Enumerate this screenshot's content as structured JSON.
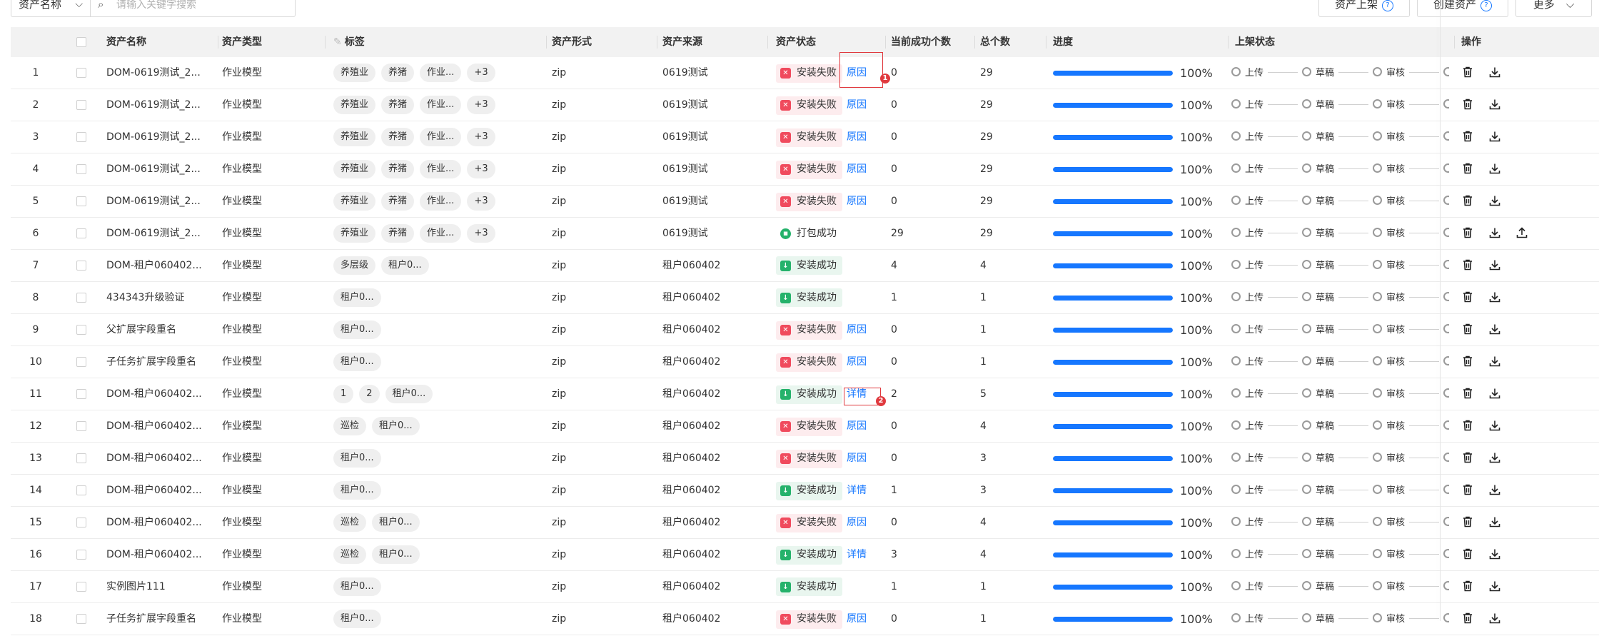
{
  "toolbar": {
    "field_select": "资产名称",
    "search_placeholder": "请输入关键字搜索",
    "publish_label": "资产上架",
    "create_label": "创建资产",
    "more_label": "更多"
  },
  "table": {
    "headers": {
      "name": "资产名称",
      "type": "资产类型",
      "tags": "标签",
      "form": "资产形式",
      "source": "资产来源",
      "status": "资产状态",
      "success": "当前成功个数",
      "total": "总个数",
      "progress": "进度",
      "publish": "上架状态",
      "ops": "操作"
    },
    "steps": [
      "上传",
      "草稿",
      "审核"
    ],
    "rows": [
      {
        "idx": "1",
        "name": "DOM-0619测试_2...",
        "type": "作业模型",
        "tags": [
          "养殖业",
          "养猪",
          "作业..."
        ],
        "more": "+3",
        "form": "zip",
        "source": "0619测试",
        "status": "fail",
        "status_text": "安装失败",
        "link": "原因",
        "success": "0",
        "total": "29",
        "progress_text": "100%",
        "progress": 1.0,
        "upload": false
      },
      {
        "idx": "2",
        "name": "DOM-0619测试_2...",
        "type": "作业模型",
        "tags": [
          "养殖业",
          "养猪",
          "作业..."
        ],
        "more": "+3",
        "form": "zip",
        "source": "0619测试",
        "status": "fail",
        "status_text": "安装失败",
        "link": "原因",
        "success": "0",
        "total": "29",
        "progress_text": "100%",
        "progress": 1.0,
        "upload": false
      },
      {
        "idx": "3",
        "name": "DOM-0619测试_2...",
        "type": "作业模型",
        "tags": [
          "养殖业",
          "养猪",
          "作业..."
        ],
        "more": "+3",
        "form": "zip",
        "source": "0619测试",
        "status": "fail",
        "status_text": "安装失败",
        "link": "原因",
        "success": "0",
        "total": "29",
        "progress_text": "100%",
        "progress": 1.0,
        "upload": false
      },
      {
        "idx": "4",
        "name": "DOM-0619测试_2...",
        "type": "作业模型",
        "tags": [
          "养殖业",
          "养猪",
          "作业..."
        ],
        "more": "+3",
        "form": "zip",
        "source": "0619测试",
        "status": "fail",
        "status_text": "安装失败",
        "link": "原因",
        "success": "0",
        "total": "29",
        "progress_text": "100%",
        "progress": 1.0,
        "upload": false
      },
      {
        "idx": "5",
        "name": "DOM-0619测试_2...",
        "type": "作业模型",
        "tags": [
          "养殖业",
          "养猪",
          "作业..."
        ],
        "more": "+3",
        "form": "zip",
        "source": "0619测试",
        "status": "fail",
        "status_text": "安装失败",
        "link": "原因",
        "success": "0",
        "total": "29",
        "progress_text": "100%",
        "progress": 1.0,
        "upload": false
      },
      {
        "idx": "6",
        "name": "DOM-0619测试_2...",
        "type": "作业模型",
        "tags": [
          "养殖业",
          "养猪",
          "作业..."
        ],
        "more": "+3",
        "form": "zip",
        "source": "0619测试",
        "status": "pack",
        "status_text": "打包成功",
        "link": "",
        "success": "29",
        "total": "29",
        "progress_text": "100%",
        "progress": 1.0,
        "upload": true
      },
      {
        "idx": "7",
        "name": "DOM-租户060402...",
        "type": "作业模型",
        "tags": [
          "多层级",
          "租户0..."
        ],
        "more": "",
        "form": "zip",
        "source": "租户060402",
        "status": "ok",
        "status_text": "安装成功",
        "link": "",
        "success": "4",
        "total": "4",
        "progress_text": "100%",
        "progress": 1.0,
        "upload": false
      },
      {
        "idx": "8",
        "name": "434343升级验证",
        "type": "作业模型",
        "tags": [
          "租户0..."
        ],
        "more": "",
        "form": "zip",
        "source": "租户060402",
        "status": "ok",
        "status_text": "安装成功",
        "link": "",
        "success": "1",
        "total": "1",
        "progress_text": "100%",
        "progress": 1.0,
        "upload": false
      },
      {
        "idx": "9",
        "name": "父扩展字段重名",
        "type": "作业模型",
        "tags": [
          "租户0..."
        ],
        "more": "",
        "form": "zip",
        "source": "租户060402",
        "status": "fail",
        "status_text": "安装失败",
        "link": "原因",
        "success": "0",
        "total": "1",
        "progress_text": "100%",
        "progress": 1.0,
        "upload": false
      },
      {
        "idx": "10",
        "name": "子任务扩展字段重名",
        "type": "作业模型",
        "tags": [
          "租户0..."
        ],
        "more": "",
        "form": "zip",
        "source": "租户060402",
        "status": "fail",
        "status_text": "安装失败",
        "link": "原因",
        "success": "0",
        "total": "1",
        "progress_text": "100%",
        "progress": 1.0,
        "upload": false
      },
      {
        "idx": "11",
        "name": "DOM-租户060402...",
        "type": "作业模型",
        "tags": [
          "1",
          "2",
          "租户0..."
        ],
        "more": "",
        "form": "zip",
        "source": "租户060402",
        "status": "ok",
        "status_text": "安装成功",
        "link": "详情",
        "success": "2",
        "total": "5",
        "progress_text": "100%",
        "progress": 1.0,
        "upload": false
      },
      {
        "idx": "12",
        "name": "DOM-租户060402...",
        "type": "作业模型",
        "tags": [
          "巡检",
          "租户0..."
        ],
        "more": "",
        "form": "zip",
        "source": "租户060402",
        "status": "fail",
        "status_text": "安装失败",
        "link": "原因",
        "success": "0",
        "total": "4",
        "progress_text": "100%",
        "progress": 1.0,
        "upload": false
      },
      {
        "idx": "13",
        "name": "DOM-租户060402...",
        "type": "作业模型",
        "tags": [
          "租户0..."
        ],
        "more": "",
        "form": "zip",
        "source": "租户060402",
        "status": "fail",
        "status_text": "安装失败",
        "link": "原因",
        "success": "0",
        "total": "3",
        "progress_text": "100%",
        "progress": 1.0,
        "upload": false
      },
      {
        "idx": "14",
        "name": "DOM-租户060402...",
        "type": "作业模型",
        "tags": [
          "租户0..."
        ],
        "more": "",
        "form": "zip",
        "source": "租户060402",
        "status": "ok",
        "status_text": "安装成功",
        "link": "详情",
        "success": "1",
        "total": "3",
        "progress_text": "100%",
        "progress": 1.0,
        "upload": false
      },
      {
        "idx": "15",
        "name": "DOM-租户060402...",
        "type": "作业模型",
        "tags": [
          "巡检",
          "租户0..."
        ],
        "more": "",
        "form": "zip",
        "source": "租户060402",
        "status": "fail",
        "status_text": "安装失败",
        "link": "原因",
        "success": "0",
        "total": "4",
        "progress_text": "100%",
        "progress": 1.0,
        "upload": false
      },
      {
        "idx": "16",
        "name": "DOM-租户060402...",
        "type": "作业模型",
        "tags": [
          "巡检",
          "租户0..."
        ],
        "more": "",
        "form": "zip",
        "source": "租户060402",
        "status": "ok",
        "status_text": "安装成功",
        "link": "详情",
        "success": "3",
        "total": "4",
        "progress_text": "100%",
        "progress": 1.0,
        "upload": false
      },
      {
        "idx": "17",
        "name": "实例图片111",
        "type": "作业模型",
        "tags": [
          "租户0..."
        ],
        "more": "",
        "form": "zip",
        "source": "租户060402",
        "status": "ok",
        "status_text": "安装成功",
        "link": "",
        "success": "1",
        "total": "1",
        "progress_text": "100%",
        "progress": 1.0,
        "upload": false
      },
      {
        "idx": "18",
        "name": "子任务扩展字段重名",
        "type": "作业模型",
        "tags": [
          "租户0..."
        ],
        "more": "",
        "form": "zip",
        "source": "租户060402",
        "status": "fail",
        "status_text": "安装失败",
        "link": "原因",
        "success": "0",
        "total": "1",
        "progress_text": "100%",
        "progress": 1.0,
        "upload": false
      }
    ]
  },
  "annotations": [
    {
      "label": "1",
      "color": "#e0393e"
    },
    {
      "label": "2",
      "color": "#e0393e"
    }
  ],
  "icons": {
    "delete": "trash-icon",
    "download": "download-icon",
    "upload": "upload-icon",
    "search": "search-icon",
    "help": "help-icon",
    "chevron": "chevron-down-icon"
  }
}
